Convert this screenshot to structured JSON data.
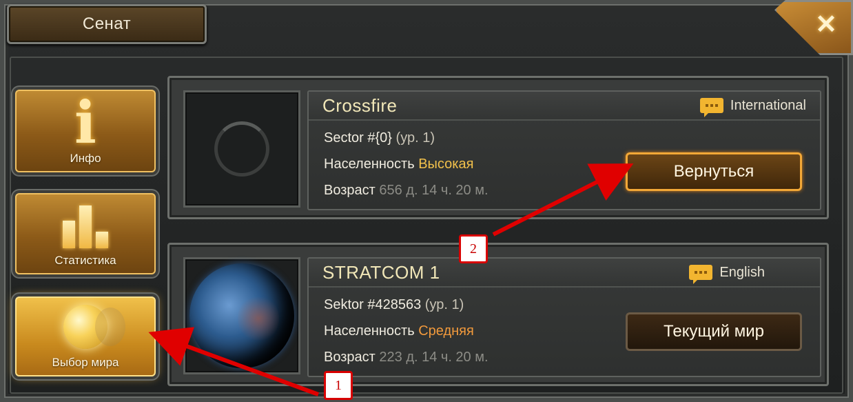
{
  "window": {
    "title": "Сенат",
    "close_icon": "close-icon"
  },
  "sidebar": {
    "items": [
      {
        "label": "Инфо",
        "icon": "info-icon",
        "active": false
      },
      {
        "label": "Статистика",
        "icon": "bar-chart-icon",
        "active": false
      },
      {
        "label": "Выбор мира",
        "icon": "globe-icon",
        "active": true
      }
    ]
  },
  "worlds": [
    {
      "name": "Crossfire",
      "language": "International",
      "sector_label": "Sector #{0}",
      "sector_level": "(ур. 1)",
      "population_label": "Населенность",
      "population_value": "Высокая",
      "age_label": "Возраст",
      "age_value": "656 д. 14 ч. 20 м.",
      "button": "Вернуться",
      "thumbnail": "loading-spinner"
    },
    {
      "name": "STRATCOM 1",
      "language": "English",
      "sector_label": "Sektor #428563",
      "sector_level": "(ур. 1)",
      "population_label": "Населенность",
      "population_value": "Средняя",
      "age_label": "Возраст",
      "age_value": "223 д. 14 ч. 20 м.",
      "button": "Текущий мир",
      "thumbnail": "planet-image"
    }
  ],
  "annotations": {
    "marker_1": "1",
    "marker_2": "2"
  },
  "colors": {
    "accent_gold": "#f2c14b",
    "accent_orange": "#f29a3c",
    "callout_red": "#e00000"
  }
}
